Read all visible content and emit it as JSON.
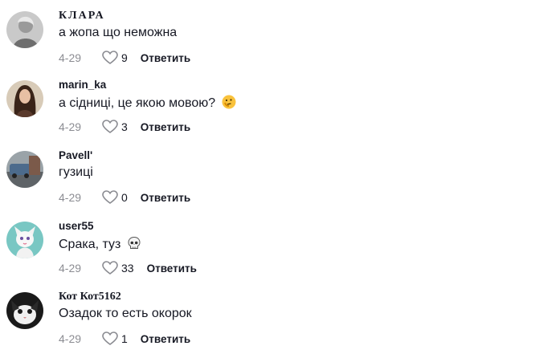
{
  "comments": [
    {
      "username": "КЛАРА",
      "text": "а жопа що неможна",
      "emoji": "",
      "date": "4-29",
      "likes": "9",
      "reply": "Ответить"
    },
    {
      "username": "marin_ka",
      "text": "а сідниці, це якою мовою?",
      "emoji": "thinking-face-emoji",
      "date": "4-29",
      "likes": "3",
      "reply": "Ответить"
    },
    {
      "username": "Pavell'",
      "text": "гузиці",
      "emoji": "",
      "date": "4-29",
      "likes": "0",
      "reply": "Ответить"
    },
    {
      "username": "user55",
      "text": "Срака, туз",
      "emoji": "skull-emoji",
      "date": "4-29",
      "likes": "33",
      "reply": "Ответить"
    },
    {
      "username": "Кот Кот5162",
      "text": "Озадок то есть окорок",
      "emoji": "",
      "date": "4-29",
      "likes": "1",
      "reply": "Ответить"
    }
  ],
  "colors": {
    "text": "#161823",
    "muted": "#8a8b91"
  }
}
